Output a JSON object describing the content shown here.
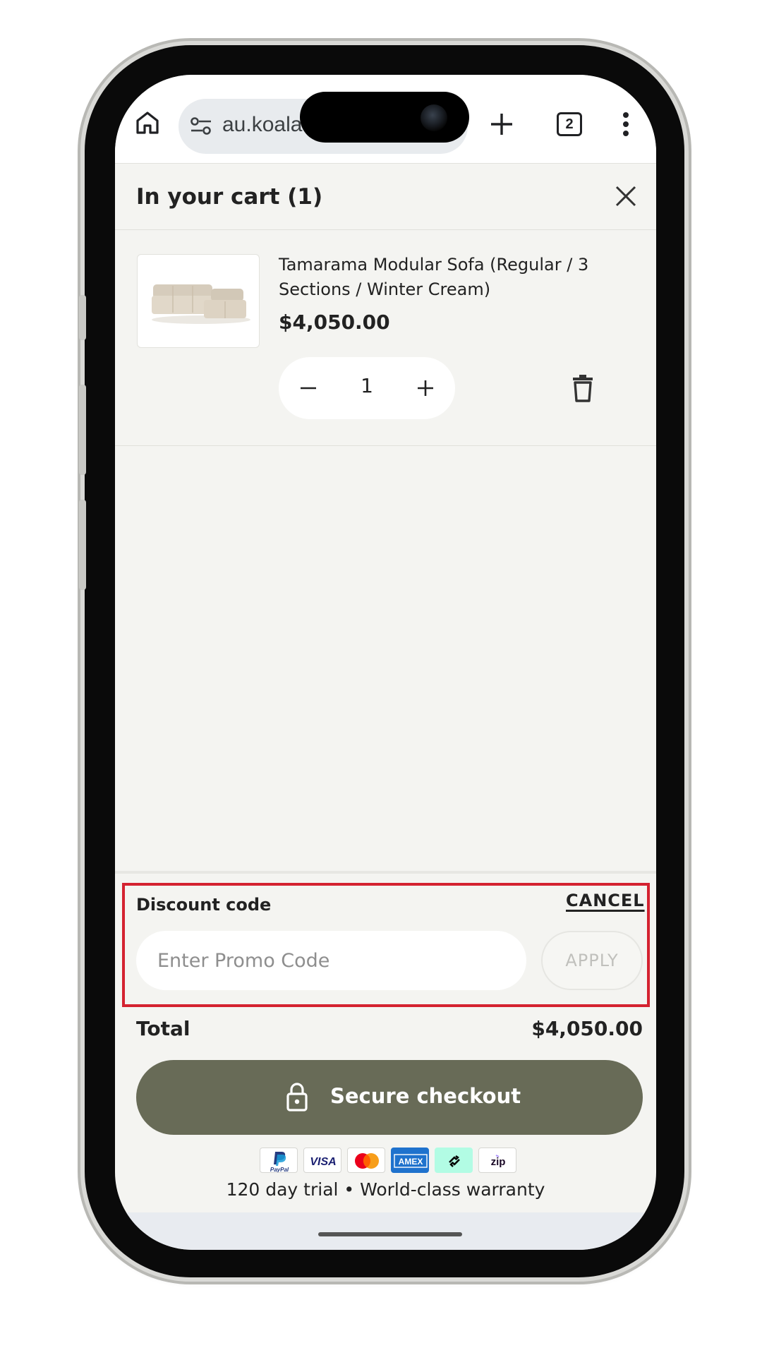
{
  "browser": {
    "url_text": "au.koala",
    "tab_count": "2",
    "icons": [
      "home-icon",
      "site-settings-icon",
      "plus-icon",
      "tab-switcher-icon",
      "more-vert-icon"
    ]
  },
  "cart": {
    "title": "In your cart (1)",
    "close_icon": "close-icon"
  },
  "item": {
    "name": "Tamarama Modular Sofa (Regular / 3 Sections / Winter Cream)",
    "price": "$4,050.00",
    "quantity": "1",
    "image_alt": "sofa-image"
  },
  "discount": {
    "label": "Discount code",
    "cancel": "CANCEL",
    "placeholder": "Enter Promo Code",
    "apply": "APPLY",
    "highlight_color": "#d42230"
  },
  "summary": {
    "total_label": "Total",
    "total_value": "$4,050.00"
  },
  "checkout": {
    "label": "Secure checkout",
    "color": "#686b57"
  },
  "payments": {
    "paypal": "PayPal",
    "visa": "VISA",
    "amex": "AMEX",
    "zip": "zip",
    "icons": [
      "paypal-icon",
      "visa-icon",
      "mastercard-icon",
      "amex-icon",
      "afterpay-icon",
      "zip-icon"
    ]
  },
  "guarantee": "120 day trial • World-class warranty"
}
